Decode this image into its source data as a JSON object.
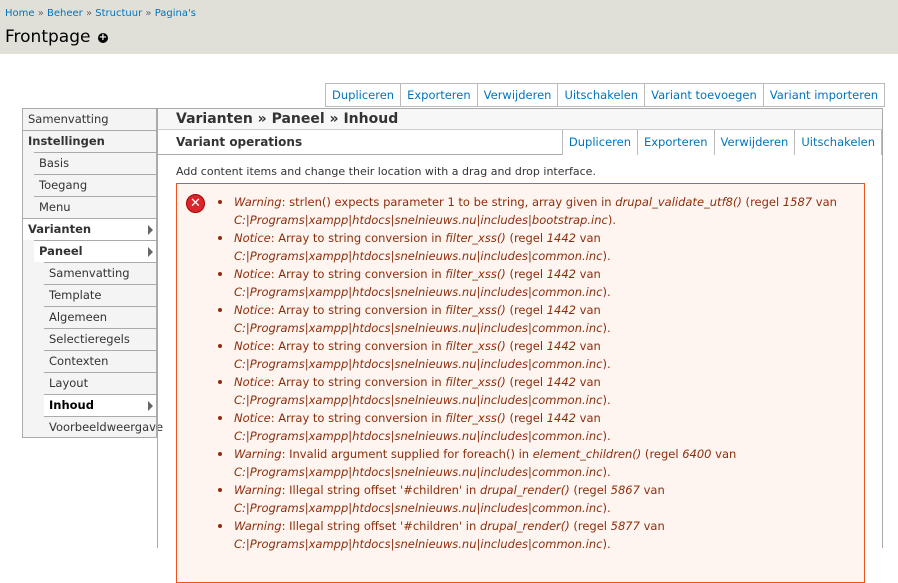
{
  "breadcrumb": [
    "Home",
    "Beheer",
    "Structuur",
    "Pagina's"
  ],
  "breadcrumb_sep": "»",
  "page_title": "Frontpage",
  "top_tabs": [
    "Dupliceren",
    "Exporteren",
    "Verwijderen",
    "Uitschakelen",
    "Variant toevoegen",
    "Variant importeren"
  ],
  "sidebar": [
    {
      "label": "Samenvatting",
      "level": 0,
      "bold": false,
      "active": false,
      "arrow": false
    },
    {
      "label": "Instellingen",
      "level": 0,
      "bold": true,
      "active": false,
      "arrow": false
    },
    {
      "label": "Basis",
      "level": 1,
      "bold": false,
      "active": false,
      "arrow": false
    },
    {
      "label": "Toegang",
      "level": 1,
      "bold": false,
      "active": false,
      "arrow": false
    },
    {
      "label": "Menu",
      "level": 1,
      "bold": false,
      "active": false,
      "arrow": false
    },
    {
      "label": "Varianten",
      "level": 0,
      "bold": true,
      "active": true,
      "arrow": true
    },
    {
      "label": "Paneel",
      "level": 1,
      "bold": true,
      "active": true,
      "arrow": true
    },
    {
      "label": "Samenvatting",
      "level": 2,
      "bold": false,
      "active": false,
      "arrow": false
    },
    {
      "label": "Template",
      "level": 2,
      "bold": false,
      "active": false,
      "arrow": false
    },
    {
      "label": "Algemeen",
      "level": 2,
      "bold": false,
      "active": false,
      "arrow": false
    },
    {
      "label": "Selectieregels",
      "level": 2,
      "bold": false,
      "active": false,
      "arrow": false
    },
    {
      "label": "Contexten",
      "level": 2,
      "bold": false,
      "active": false,
      "arrow": false
    },
    {
      "label": "Layout",
      "level": 2,
      "bold": false,
      "active": false,
      "arrow": false
    },
    {
      "label": "Inhoud",
      "level": 2,
      "bold": true,
      "active": true,
      "arrow": true
    },
    {
      "label": "Voorbeeldweergave",
      "level": 2,
      "bold": false,
      "active": false,
      "arrow": false
    }
  ],
  "main_title": "Varianten » Paneel » Inhoud",
  "ops_label": "Variant operations",
  "ops_tabs": [
    "Dupliceren",
    "Exporteren",
    "Verwijderen",
    "Uitschakelen"
  ],
  "description": "Add content items and change their location with a drag and drop interface.",
  "errors": [
    {
      "type": "Warning",
      "msg": ": strlen() expects parameter 1 to be string, array given in ",
      "func": "drupal_validate_utf8()",
      "line": "1587",
      "file": "C:|Programs|xampp|htdocs|snelnieuws.nu|includes|bootstrap.inc"
    },
    {
      "type": "Notice",
      "msg": ": Array to string conversion in ",
      "func": "filter_xss()",
      "line": "1442",
      "file": "C:|Programs|xampp|htdocs|snelnieuws.nu|includes|common.inc"
    },
    {
      "type": "Notice",
      "msg": ": Array to string conversion in ",
      "func": "filter_xss()",
      "line": "1442",
      "file": "C:|Programs|xampp|htdocs|snelnieuws.nu|includes|common.inc"
    },
    {
      "type": "Notice",
      "msg": ": Array to string conversion in ",
      "func": "filter_xss()",
      "line": "1442",
      "file": "C:|Programs|xampp|htdocs|snelnieuws.nu|includes|common.inc"
    },
    {
      "type": "Notice",
      "msg": ": Array to string conversion in ",
      "func": "filter_xss()",
      "line": "1442",
      "file": "C:|Programs|xampp|htdocs|snelnieuws.nu|includes|common.inc"
    },
    {
      "type": "Notice",
      "msg": ": Array to string conversion in ",
      "func": "filter_xss()",
      "line": "1442",
      "file": "C:|Programs|xampp|htdocs|snelnieuws.nu|includes|common.inc"
    },
    {
      "type": "Notice",
      "msg": ": Array to string conversion in ",
      "func": "filter_xss()",
      "line": "1442",
      "file": "C:|Programs|xampp|htdocs|snelnieuws.nu|includes|common.inc"
    },
    {
      "type": "Warning",
      "msg": ": Invalid argument supplied for foreach() in ",
      "func": "element_children()",
      "line": "6400",
      "file": "C:|Programs|xampp|htdocs|snelnieuws.nu|includes|common.inc"
    },
    {
      "type": "Warning",
      "msg": ": Illegal string offset '#children' in ",
      "func": "drupal_render()",
      "line": "5867",
      "file": "C:|Programs|xampp|htdocs|snelnieuws.nu|includes|common.inc"
    },
    {
      "type": "Warning",
      "msg": ": Illegal string offset '#children' in ",
      "func": "drupal_render()",
      "line": "5877",
      "file": "C:|Programs|xampp|htdocs|snelnieuws.nu|includes|common.inc"
    }
  ],
  "regel_label": "regel",
  "van_label": "van",
  "colors": {
    "link": "#0074bd",
    "error_text": "#8c2e0b",
    "error_border": "#ed541d",
    "error_bg": "#fef5f1",
    "header_bg": "#e0e0d8"
  }
}
